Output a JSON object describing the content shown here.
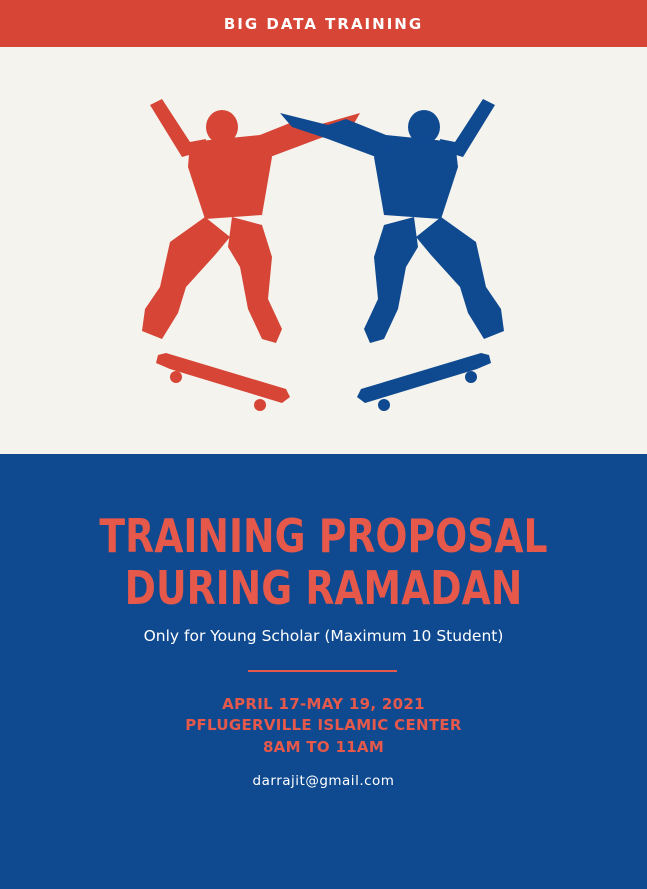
{
  "banner": {
    "text": "BIG DATA TRAINING"
  },
  "hero": {
    "left_figure_icon": "skater-silhouette-icon",
    "right_figure_icon": "skater-silhouette-icon",
    "left_board_icon": "skateboard-icon",
    "right_board_icon": "skateboard-icon",
    "colors": {
      "left": "#d64535",
      "right": "#0f4a91",
      "background": "#f4f3ee"
    }
  },
  "main": {
    "title_line1": "TRAINING PROPOSAL",
    "title_line2": "DURING RAMADAN",
    "subtitle": "Only for Young Scholar (Maximum 10 Student)",
    "dates": "APRIL 17-MAY 19, 2021",
    "location": "PFLUGERVILLE ISLAMIC CENTER",
    "time": "8AM TO 11AM",
    "email": "darrajit@gmail.com"
  },
  "colors": {
    "accent": "#e5584a",
    "banner": "#d64535",
    "blue": "#0f4a91"
  }
}
